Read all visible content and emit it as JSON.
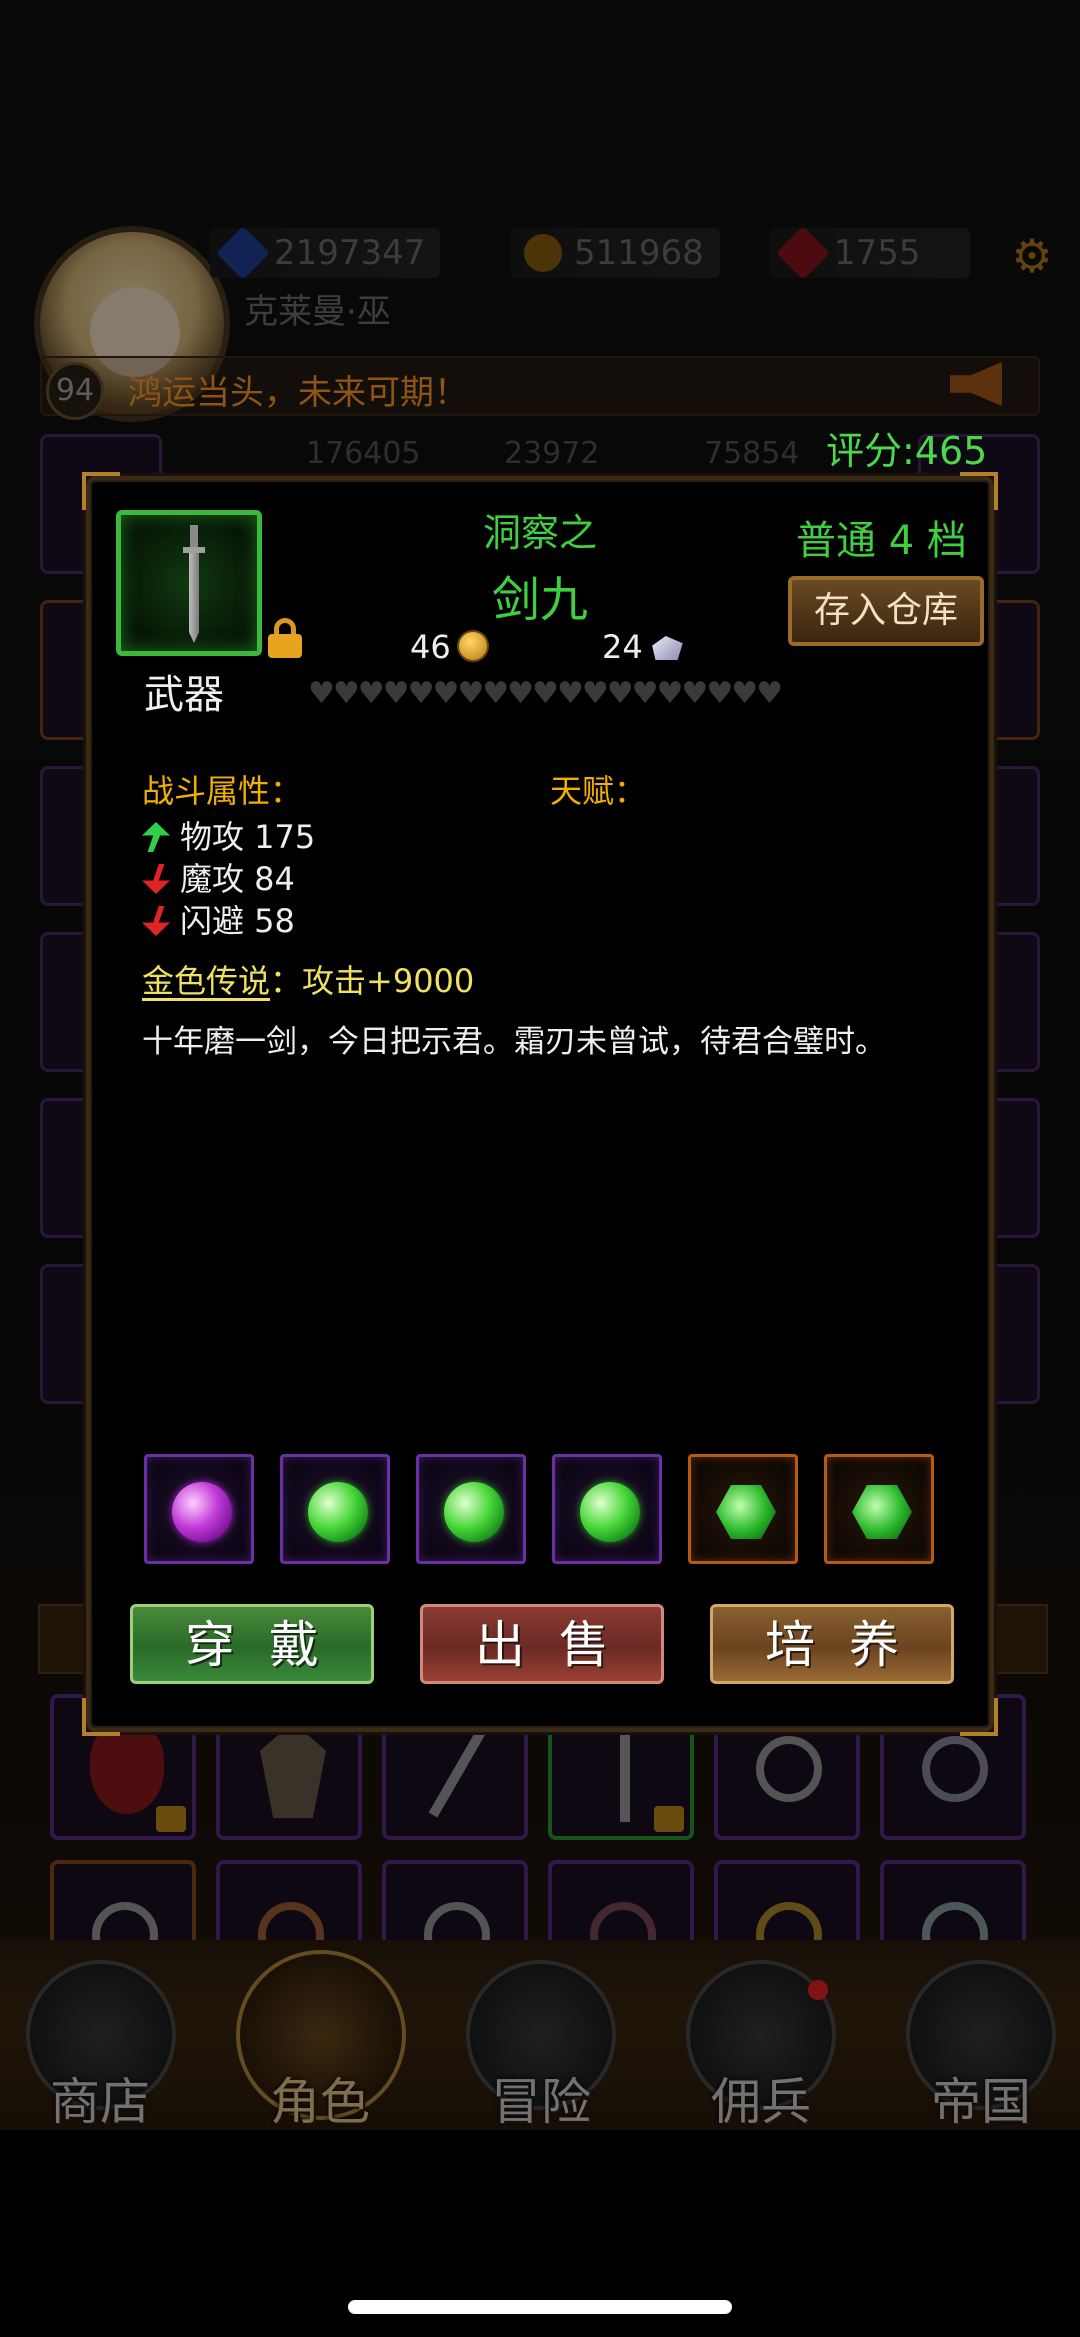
{
  "header": {
    "currencies": [
      {
        "icon": "blue-gem-icon",
        "value": "2197347",
        "color": "#2a5bd7"
      },
      {
        "icon": "gold-coin-icon",
        "value": "511968",
        "color": "#c8901a"
      },
      {
        "icon": "red-gem-icon",
        "value": "1755",
        "color": "#d02030"
      }
    ],
    "player_name": "克莱曼·巫",
    "level": "94",
    "motto": "鸿运当头，未来可期！",
    "score": "评分:465"
  },
  "background_stats": [
    "176405",
    "23972",
    "75854"
  ],
  "item": {
    "prefix": "洞察之",
    "name": "剑九",
    "grade": "普通 4 档",
    "type": "武器",
    "store_button": "存入仓库",
    "cost_gold": "46",
    "cost_ore": "24",
    "hearts": "♥♥♥♥♥♥♥♥♥♥♥♥♥♥♥♥♥♥♥",
    "combat_label": "战斗属性：",
    "talent_label": "天赋：",
    "stats": [
      {
        "label": "物攻 175",
        "trend": "up"
      },
      {
        "label": "魔攻 84",
        "trend": "down"
      },
      {
        "label": "闪避 58",
        "trend": "down"
      }
    ],
    "legend_title": "金色传说",
    "legend_text": "：攻击+9000",
    "flavor": "十年磨一剑，今日把示君。霜刃未曾试，待君合璧时。",
    "gems": [
      "purple",
      "green",
      "green",
      "green",
      "green-hex",
      "green-hex"
    ]
  },
  "actions": {
    "wear": "穿戴",
    "sell": "出售",
    "train": "培养"
  },
  "nav": {
    "shop": "商店",
    "character": "角色",
    "adventure": "冒险",
    "mercenary": "佣兵",
    "empire": "帝国"
  }
}
